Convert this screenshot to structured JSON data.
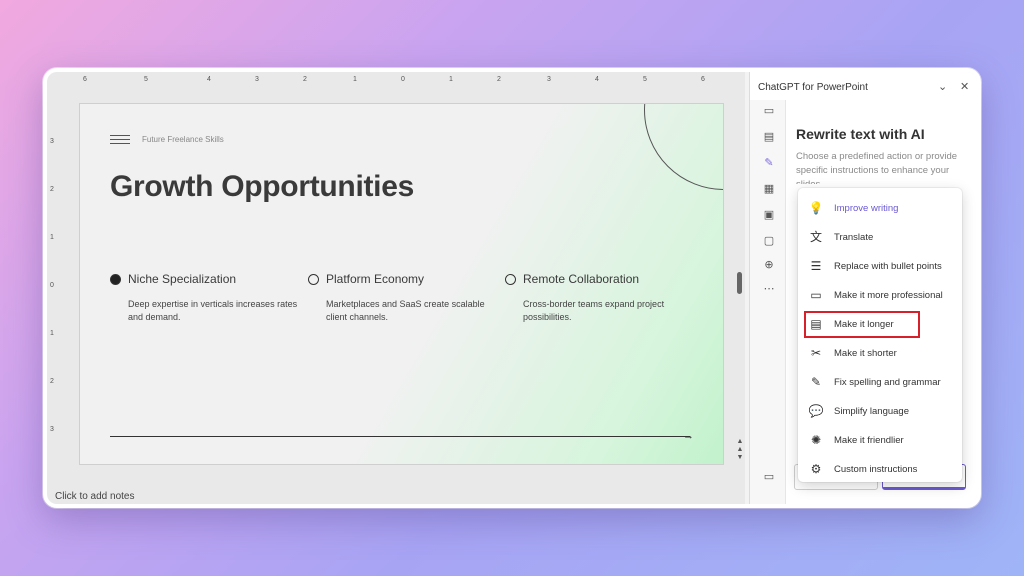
{
  "ruler": {
    "h_ticks": [
      "6",
      "5",
      "4",
      "3",
      "2",
      "1",
      "0",
      "1",
      "2",
      "3",
      "4",
      "5",
      "6"
    ],
    "v_ticks": [
      "3",
      "2",
      "1",
      "0",
      "1",
      "2",
      "3"
    ]
  },
  "slide": {
    "subtitle": "Future Freelance Skills",
    "title": "Growth Opportunities",
    "columns": [
      {
        "heading": "Niche Specialization",
        "desc": "Deep expertise in verticals increases rates and demand."
      },
      {
        "heading": "Platform Economy",
        "desc": "Marketplaces and SaaS create scalable client channels."
      },
      {
        "heading": "Remote Collaboration",
        "desc": "Cross-border teams expand project possibilities."
      }
    ],
    "arrow_glyph": "→"
  },
  "notes": "Click to add notes",
  "pane": {
    "title": "ChatGPT for PowerPoint",
    "heading": "Rewrite text with AI",
    "intro": "Choose a predefined action or provide specific instructions to enhance your slides",
    "menu": [
      {
        "label": "Improve writing",
        "icon": "lightbulb-icon",
        "glyph": "💡"
      },
      {
        "label": "Translate",
        "icon": "translate-icon",
        "glyph": "文"
      },
      {
        "label": "Replace with bullet points",
        "icon": "bullet-list-icon",
        "glyph": "☰"
      },
      {
        "label": "Make it more professional",
        "icon": "briefcase-icon",
        "glyph": "▭"
      },
      {
        "label": "Make it longer",
        "icon": "document-plus-icon",
        "glyph": "▤"
      },
      {
        "label": "Make it shorter",
        "icon": "scissors-icon",
        "glyph": "✂"
      },
      {
        "label": "Fix spelling and grammar",
        "icon": "pencil-icon",
        "glyph": "✎"
      },
      {
        "label": "Simplify language",
        "icon": "chat-icon",
        "glyph": "💬"
      },
      {
        "label": "Make it friendlier",
        "icon": "party-icon",
        "glyph": "✺"
      },
      {
        "label": "Custom instructions",
        "icon": "gear-icon",
        "glyph": "⚙"
      }
    ]
  },
  "colors": {
    "accent": "#6a59d1",
    "highlight": "#d8202a"
  }
}
